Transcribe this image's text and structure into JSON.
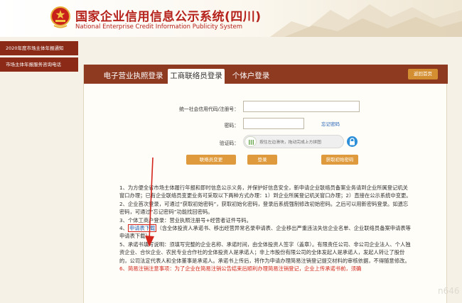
{
  "header": {
    "title_cn": "国家企业信用信息公示系统(四川)",
    "title_en": "National Enterprise Credit Information Publicity System",
    "emblem_icon": "national-emblem-icon"
  },
  "sidebar": {
    "items": [
      {
        "label": "2020年度市场主体年报通知"
      },
      {
        "label": "市场主体年报服务咨询电话"
      }
    ]
  },
  "tabs": [
    {
      "label": "电子营业执照登录",
      "active": false
    },
    {
      "label": "工商联络员登录",
      "active": true
    },
    {
      "label": "个体户登录",
      "active": false
    }
  ],
  "back_button": "返回首页",
  "form": {
    "credit_code_label": "统一社会信用代码/注册号：",
    "credit_code_value": "",
    "password_label": "密码：",
    "password_value": "",
    "forgot_password": "忘记密码",
    "captcha_label": "验证码：",
    "slider_hint": "按住左边滑块，拖动完成上方拼图",
    "buttons": {
      "change_liaison": "联络员变更",
      "login": "登录",
      "get_initial_password": "获取初始密码"
    }
  },
  "notices": {
    "n1": "1、为方便全省市场主体履行年报和即时信息公示义务，并保护好信息安全，新申请企业联络员备案业务请到企业所属登记机关窗口办理；已有企业联络员变更业务可采取以下两种方式办理：1）到企业所属登记机关窗口办理；2）直接在公示系统中变更。",
    "n2": "2、企业首次登录，可通过“获取初始密码”，获取初始化密码，登录后系统强制修改初始密码。之后可以用新密码登录。如遗忘密码，可通过“忘记密码”功能找回密码。",
    "n3": "3、个体工商户登录：营业执照注册号+经营者证件号码。",
    "n4_prefix": "4、",
    "n4_link": "申请表下载",
    "n4_suffix": "（含全体投资人承诺书、移出经营异常名录申请表、企业移出严重违法失信企业名单、企业联络员备案申请表等申请表下载）",
    "n5": "5、承诺书填写说明：须填写完整的企业名称、承诺时间，由全体投资人签字（盖章）。有限责任公司、非公司企业法人、个人独资企业、合伙企业、农民专业合作社的全体投资人是承诺人；非上市股份有限公司的全体发起人是承诺人，发起人转让了股份的，公司法定代表人和全体董事是承诺人。承诺书上传后，将作为申请办理简易注销登记提交材料的审核依据，不得随意修改。",
    "n6": "6、简易注销注意事项：为了企业在简易注销公告结束后顺利办理简易注销登记，企业上传承诺书前，须确"
  },
  "watermark": "n646",
  "colors": {
    "brand_red": "#b5221b",
    "tab_bar": "#8d3a21",
    "sidebar": "#8a2a17",
    "button_orange": "#de9a3c",
    "link_blue": "#1f5fb5",
    "annotation_red": "#d3261c"
  }
}
